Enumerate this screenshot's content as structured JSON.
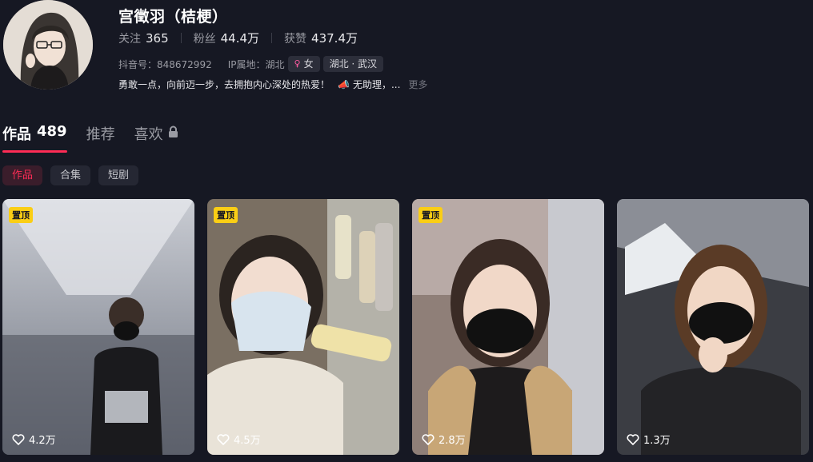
{
  "profile": {
    "name": "宫徵羽（桔梗）",
    "stats": [
      {
        "label": "关注",
        "value": "365"
      },
      {
        "label": "粉丝",
        "value": "44.4万"
      },
      {
        "label": "获赞",
        "value": "437.4万"
      }
    ],
    "douyin_id": "抖音号：848672992",
    "ip_location": "IP属地：湖北",
    "gender_tag": "女",
    "gender_icon": "female-icon",
    "region_tag": "湖北 · 武汉",
    "signature": "勇敢一点，向前迈一步，去拥抱内心深处的热爱！",
    "signature_extra": "无助理，...",
    "more": "更多"
  },
  "tabs": [
    {
      "label": "作品",
      "count": "489"
    },
    {
      "label": "推荐"
    },
    {
      "label": "喜欢"
    }
  ],
  "subtabs": [
    "作品",
    "合集",
    "短剧"
  ],
  "videos": [
    {
      "pinned": "置顶",
      "likes": "4.2万"
    },
    {
      "pinned": "置顶",
      "likes": "4.5万"
    },
    {
      "pinned": "置顶",
      "likes": "2.8万"
    },
    {
      "pinned": "",
      "likes": "1.3万"
    }
  ],
  "colors": {
    "accent": "#fe2c55",
    "background": "#161823",
    "pin": "#face15"
  }
}
